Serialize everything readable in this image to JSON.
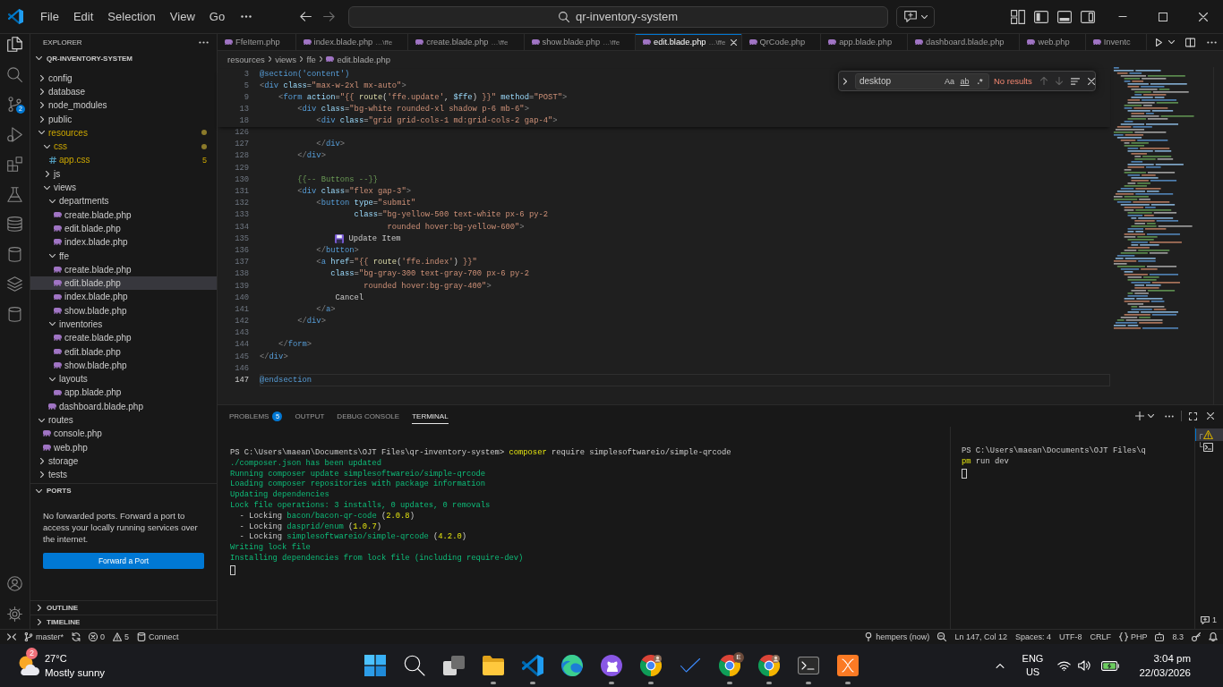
{
  "title_bar": {
    "menu": [
      "File",
      "Edit",
      "Selection",
      "View",
      "Go"
    ],
    "search": "qr-inventory-system",
    "layout_toggles": [
      {
        "kind": "primary-sidebar",
        "on": true
      },
      {
        "kind": "panel",
        "on": true
      },
      {
        "kind": "secondary-sidebar",
        "on": false
      }
    ]
  },
  "activity_bar": {
    "items": [
      {
        "kind": "explorer",
        "selected": true
      },
      {
        "kind": "search",
        "selected": false
      },
      {
        "kind": "source-control",
        "selected": false,
        "badge": "2"
      },
      {
        "kind": "run-debug",
        "selected": false
      },
      {
        "kind": "extensions",
        "selected": false
      },
      {
        "kind": "testing",
        "selected": false
      },
      {
        "kind": "database",
        "selected": false
      },
      {
        "kind": "cylinder",
        "selected": false
      },
      {
        "kind": "layers",
        "selected": false
      },
      {
        "kind": "cylinder",
        "selected": false
      }
    ],
    "bottom": [
      {
        "kind": "account"
      },
      {
        "kind": "settings"
      }
    ]
  },
  "sidebar": {
    "title": "EXPLORER",
    "root": {
      "label": "QR-INVENTORY-SYSTEM",
      "expanded": true
    },
    "tree": [
      {
        "kind": "folder",
        "label": "config",
        "expanded": false,
        "selected": false,
        "warning": false
      },
      {
        "kind": "folder",
        "label": "database",
        "expanded": false,
        "selected": false,
        "warning": false
      },
      {
        "kind": "folder",
        "label": "node_modules",
        "expanded": false,
        "selected": false,
        "warning": false
      },
      {
        "kind": "folder",
        "label": "public",
        "expanded": false,
        "selected": false,
        "warning": false
      },
      {
        "kind": "folder",
        "label": "resources",
        "expanded": true,
        "selected": false,
        "warning": true,
        "children": [
          {
            "kind": "folder",
            "label": "css",
            "expanded": true,
            "selected": false,
            "warning": true,
            "children": [
              {
                "kind": "css-file",
                "label": "app.css",
                "selected": false,
                "warning": true,
                "badge": "5"
              }
            ]
          },
          {
            "kind": "folder",
            "label": "js",
            "expanded": false,
            "selected": false,
            "warning": false
          },
          {
            "kind": "folder",
            "label": "views",
            "expanded": true,
            "selected": false,
            "warning": false,
            "children": [
              {
                "kind": "folder",
                "label": "departments",
                "expanded": true,
                "selected": false,
                "warning": false,
                "children": [
                  {
                    "kind": "php-file",
                    "label": "create.blade.php",
                    "selected": false,
                    "warning": false
                  },
                  {
                    "kind": "php-file",
                    "label": "edit.blade.php",
                    "selected": false,
                    "warning": false
                  },
                  {
                    "kind": "php-file",
                    "label": "index.blade.php",
                    "selected": false,
                    "warning": false
                  }
                ]
              },
              {
                "kind": "folder",
                "label": "ffe",
                "expanded": true,
                "selected": false,
                "warning": false,
                "children": [
                  {
                    "kind": "php-file",
                    "label": "create.blade.php",
                    "selected": false,
                    "warning": false
                  },
                  {
                    "kind": "php-file",
                    "label": "edit.blade.php",
                    "selected": true,
                    "warning": false
                  },
                  {
                    "kind": "php-file",
                    "label": "index.blade.php",
                    "selected": false,
                    "warning": false
                  },
                  {
                    "kind": "php-file",
                    "label": "show.blade.php",
                    "selected": false,
                    "warning": false
                  }
                ]
              },
              {
                "kind": "folder",
                "label": "inventories",
                "expanded": true,
                "selected": false,
                "warning": false,
                "children": [
                  {
                    "kind": "php-file",
                    "label": "create.blade.php",
                    "selected": false,
                    "warning": false
                  },
                  {
                    "kind": "php-file",
                    "label": "edit.blade.php",
                    "selected": false,
                    "warning": false
                  },
                  {
                    "kind": "php-file",
                    "label": "show.blade.php",
                    "selected": false,
                    "warning": false
                  }
                ]
              },
              {
                "kind": "folder",
                "label": "layouts",
                "expanded": true,
                "selected": false,
                "warning": false,
                "children": [
                  {
                    "kind": "php-file",
                    "label": "app.blade.php",
                    "selected": false,
                    "warning": false
                  }
                ]
              },
              {
                "kind": "php-file",
                "label": "dashboard.blade.php",
                "selected": false,
                "warning": false
              }
            ]
          }
        ]
      },
      {
        "kind": "folder",
        "label": "routes",
        "expanded": true,
        "selected": false,
        "warning": false,
        "children": [
          {
            "kind": "php-file",
            "label": "console.php",
            "selected": false,
            "warning": false
          },
          {
            "kind": "php-file",
            "label": "web.php",
            "selected": false,
            "warning": false
          }
        ]
      },
      {
        "kind": "folder",
        "label": "storage",
        "expanded": false,
        "selected": false,
        "warning": false
      },
      {
        "kind": "folder",
        "label": "tests",
        "expanded": false,
        "selected": false,
        "warning": false
      }
    ],
    "sections": [
      {
        "title": "PORTS",
        "expanded": true,
        "message": "No forwarded ports. Forward a port to access your locally running services over the internet.",
        "button": "Forward a Port"
      },
      {
        "title": "OUTLINE",
        "expanded": false
      },
      {
        "title": "TIMELINE",
        "expanded": false
      }
    ]
  },
  "editor": {
    "tabs": [
      {
        "label": "FfeItem.php",
        "selected": false
      },
      {
        "label": "index.blade.php",
        "description": "…\\ffe",
        "selected": false
      },
      {
        "label": "create.blade.php",
        "description": "…\\ffe",
        "selected": false
      },
      {
        "label": "show.blade.php",
        "description": "…\\ffe",
        "selected": false
      },
      {
        "label": "edit.blade.php",
        "description": "…\\ffe",
        "selected": true
      },
      {
        "label": "QrCode.php",
        "selected": false
      },
      {
        "label": "app.blade.php",
        "selected": false
      },
      {
        "label": "dashboard.blade.php",
        "selected": false
      },
      {
        "label": "web.php",
        "selected": false
      },
      {
        "label": "Inventc",
        "selected": false
      }
    ],
    "breadcrumbs": [
      "resources",
      "views",
      "ffe",
      "edit.blade.php"
    ],
    "find": {
      "replace_expanded": false,
      "value": "desktop",
      "options": [
        {
          "label": "Aa",
          "on": false
        },
        {
          "label": "ab",
          "on": false
        },
        {
          "label": ".*",
          "on": false
        }
      ],
      "result": "No results",
      "navigation_disabled": true
    },
    "sticky_lines": [
      {
        "number": "3",
        "tokens": [
          {
            "kind": "directive",
            "text": "@section('content')"
          }
        ]
      },
      {
        "number": "5",
        "tokens": [
          {
            "kind": "bracket",
            "text": "<"
          },
          {
            "kind": "tag",
            "text": "div"
          },
          {
            "kind": "attribute",
            "text": " class"
          },
          {
            "kind": "plain",
            "text": "="
          },
          {
            "kind": "string",
            "text": "\"max-w-2xl mx-auto\""
          },
          {
            "kind": "bracket",
            "text": ">"
          }
        ]
      },
      {
        "number": "9",
        "tokens": [
          {
            "kind": "bracket",
            "text": "    <"
          },
          {
            "kind": "tag",
            "text": "form"
          },
          {
            "kind": "attribute",
            "text": " action"
          },
          {
            "kind": "plain",
            "text": "="
          },
          {
            "kind": "string",
            "text": "\"{{ "
          },
          {
            "kind": "function",
            "text": "route"
          },
          {
            "kind": "plain",
            "text": "("
          },
          {
            "kind": "string",
            "text": "'ffe.update'"
          },
          {
            "kind": "plain",
            "text": ", "
          },
          {
            "kind": "variable",
            "text": "$ffe"
          },
          {
            "kind": "plain",
            "text": ") "
          },
          {
            "kind": "string",
            "text": "}}\""
          },
          {
            "kind": "attribute",
            "text": " method"
          },
          {
            "kind": "plain",
            "text": "="
          },
          {
            "kind": "string",
            "text": "\"POST\""
          },
          {
            "kind": "bracket",
            "text": ">"
          }
        ]
      },
      {
        "number": "13",
        "tokens": [
          {
            "kind": "bracket",
            "text": "        <"
          },
          {
            "kind": "tag",
            "text": "div"
          },
          {
            "kind": "attribute",
            "text": " class"
          },
          {
            "kind": "plain",
            "text": "="
          },
          {
            "kind": "string",
            "text": "\"bg-white rounded-xl shadow p-6 mb-6\""
          },
          {
            "kind": "bracket",
            "text": ">"
          }
        ]
      },
      {
        "number": "18",
        "tokens": [
          {
            "kind": "bracket",
            "text": "            <"
          },
          {
            "kind": "tag",
            "text": "div"
          },
          {
            "kind": "attribute",
            "text": " class"
          },
          {
            "kind": "plain",
            "text": "="
          },
          {
            "kind": "string",
            "text": "\"grid grid-cols-1 md:grid-cols-2 gap-4\""
          },
          {
            "kind": "bracket",
            "text": ">"
          }
        ]
      }
    ],
    "lines": [
      {
        "number": "126",
        "current": false
      },
      {
        "number": "127",
        "current": false,
        "tokens": [
          {
            "kind": "bracket",
            "text": "            </"
          },
          {
            "kind": "tag",
            "text": "div"
          },
          {
            "kind": "bracket",
            "text": ">"
          }
        ]
      },
      {
        "number": "128",
        "current": false,
        "tokens": [
          {
            "kind": "bracket",
            "text": "        </"
          },
          {
            "kind": "tag",
            "text": "div"
          },
          {
            "kind": "bracket",
            "text": ">"
          }
        ]
      },
      {
        "number": "129",
        "current": false
      },
      {
        "number": "130",
        "current": false,
        "tokens": [
          {
            "kind": "comment",
            "text": "        {{-- Buttons --}}"
          }
        ]
      },
      {
        "number": "131",
        "current": false,
        "tokens": [
          {
            "kind": "bracket",
            "text": "        <"
          },
          {
            "kind": "tag",
            "text": "div"
          },
          {
            "kind": "attribute",
            "text": " class"
          },
          {
            "kind": "plain",
            "text": "="
          },
          {
            "kind": "string",
            "text": "\"flex gap-3\""
          },
          {
            "kind": "bracket",
            "text": ">"
          }
        ]
      },
      {
        "number": "132",
        "current": false,
        "tokens": [
          {
            "kind": "bracket",
            "text": "            <"
          },
          {
            "kind": "tag",
            "text": "button"
          },
          {
            "kind": "attribute",
            "text": " type"
          },
          {
            "kind": "plain",
            "text": "="
          },
          {
            "kind": "string",
            "text": "\"submit\""
          }
        ]
      },
      {
        "number": "133",
        "current": false,
        "tokens": [
          {
            "kind": "attribute",
            "text": "                    class"
          },
          {
            "kind": "plain",
            "text": "="
          },
          {
            "kind": "string",
            "text": "\"bg-yellow-500 text-white px-6 py-2"
          }
        ]
      },
      {
        "number": "134",
        "current": false,
        "tokens": [
          {
            "kind": "string",
            "text": "                           rounded hover:bg-yellow-600\""
          },
          {
            "kind": "bracket",
            "text": ">"
          }
        ]
      },
      {
        "number": "135",
        "current": false,
        "tokens": [
          {
            "kind": "emoji",
            "text": "                Update Item"
          }
        ]
      },
      {
        "number": "136",
        "current": false,
        "tokens": [
          {
            "kind": "bracket",
            "text": "            </"
          },
          {
            "kind": "tag",
            "text": "button"
          },
          {
            "kind": "bracket",
            "text": ">"
          }
        ]
      },
      {
        "number": "137",
        "current": false,
        "tokens": [
          {
            "kind": "bracket",
            "text": "            <"
          },
          {
            "kind": "tag",
            "text": "a"
          },
          {
            "kind": "attribute",
            "text": " href"
          },
          {
            "kind": "plain",
            "text": "="
          },
          {
            "kind": "string",
            "text": "\"{{ "
          },
          {
            "kind": "function",
            "text": "route"
          },
          {
            "kind": "plain",
            "text": "("
          },
          {
            "kind": "string",
            "text": "'ffe.index'"
          },
          {
            "kind": "plain",
            "text": ") "
          },
          {
            "kind": "string",
            "text": "}}\""
          }
        ]
      },
      {
        "number": "138",
        "current": false,
        "tokens": [
          {
            "kind": "attribute",
            "text": "               class"
          },
          {
            "kind": "plain",
            "text": "="
          },
          {
            "kind": "string",
            "text": "\"bg-gray-300 text-gray-700 px-6 py-2"
          }
        ]
      },
      {
        "number": "139",
        "current": false,
        "tokens": [
          {
            "kind": "string",
            "text": "                      rounded hover:bg-gray-400\""
          },
          {
            "kind": "bracket",
            "text": ">"
          }
        ]
      },
      {
        "number": "140",
        "current": false,
        "tokens": [
          {
            "kind": "plain",
            "text": "                Cancel"
          }
        ]
      },
      {
        "number": "141",
        "current": false,
        "tokens": [
          {
            "kind": "bracket",
            "text": "            </"
          },
          {
            "kind": "tag",
            "text": "a"
          },
          {
            "kind": "bracket",
            "text": ">"
          }
        ]
      },
      {
        "number": "142",
        "current": false,
        "tokens": [
          {
            "kind": "bracket",
            "text": "        </"
          },
          {
            "kind": "tag",
            "text": "div"
          },
          {
            "kind": "bracket",
            "text": ">"
          }
        ]
      },
      {
        "number": "143",
        "current": false
      },
      {
        "number": "144",
        "current": false,
        "tokens": [
          {
            "kind": "bracket",
            "text": "    </"
          },
          {
            "kind": "tag",
            "text": "form"
          },
          {
            "kind": "bracket",
            "text": ">"
          }
        ]
      },
      {
        "number": "145",
        "current": false,
        "tokens": [
          {
            "kind": "bracket",
            "text": "</"
          },
          {
            "kind": "tag",
            "text": "div"
          },
          {
            "kind": "bracket",
            "text": ">"
          }
        ]
      },
      {
        "number": "146",
        "current": false
      },
      {
        "number": "147",
        "current": true,
        "tokens": [
          {
            "kind": "directive",
            "text": "@endsection"
          }
        ]
      }
    ]
  },
  "panel": {
    "tabs": [
      {
        "label": "PROBLEMS",
        "badge": "5",
        "selected": false
      },
      {
        "label": "OUTPUT",
        "selected": false
      },
      {
        "label": "DEBUG CONSOLE",
        "selected": false
      },
      {
        "label": "TERMINAL",
        "selected": true
      }
    ],
    "terminals": [
      {
        "lines": [
          [
            {
              "kind": "plain",
              "text": "PS C:\\Users\\maean\\Documents\\OJT Files\\qr-inventory-system> "
            },
            {
              "kind": "command",
              "text": "composer"
            },
            {
              "kind": "plain",
              "text": " require simplesoftwareio/simple-qrcode"
            }
          ],
          [
            {
              "kind": "success",
              "text": "./composer.json has been updated"
            }
          ],
          [
            {
              "kind": "success",
              "text": "Running composer update simplesoftwareio/simple-qrcode"
            }
          ],
          [
            {
              "kind": "success",
              "text": "Loading composer repositories with package information"
            }
          ],
          [
            {
              "kind": "success",
              "text": "Updating dependencies"
            }
          ],
          [
            {
              "kind": "success",
              "text": "Lock file operations: 3 installs, 0 updates, 0 removals"
            }
          ],
          [
            {
              "kind": "plain",
              "text": "  - Locking "
            },
            {
              "kind": "success",
              "text": "bacon/bacon-qr-code"
            },
            {
              "kind": "plain",
              "text": " ("
            },
            {
              "kind": "version",
              "text": "2.0.8"
            },
            {
              "kind": "plain",
              "text": ")"
            }
          ],
          [
            {
              "kind": "plain",
              "text": "  - Locking "
            },
            {
              "kind": "success",
              "text": "dasprid/enum"
            },
            {
              "kind": "plain",
              "text": " ("
            },
            {
              "kind": "version",
              "text": "1.0.7"
            },
            {
              "kind": "plain",
              "text": ")"
            }
          ],
          [
            {
              "kind": "plain",
              "text": "  - Locking "
            },
            {
              "kind": "success",
              "text": "simplesoftwareio/simple-qrcode"
            },
            {
              "kind": "plain",
              "text": " ("
            },
            {
              "kind": "version",
              "text": "4.2.0"
            },
            {
              "kind": "plain",
              "text": ")"
            }
          ],
          [
            {
              "kind": "success",
              "text": "Writing lock file"
            }
          ],
          [
            {
              "kind": "success",
              "text": "Installing dependencies from lock file (including require-dev)"
            }
          ]
        ]
      },
      {
        "lines": [
          [
            {
              "kind": "plain",
              "text": "PS C:\\Users\\maean\\Documents\\OJT Files\\q"
            }
          ],
          [
            {
              "kind": "command",
              "text": "pm"
            },
            {
              "kind": "plain",
              "text": " run dev"
            }
          ]
        ]
      }
    ],
    "terminal_list": [
      {
        "connector": "┌",
        "kind": "warning",
        "selected": true
      },
      {
        "connector": "└",
        "kind": "shell",
        "selected": false
      }
    ],
    "terminal_count": "1"
  },
  "status_bar": {
    "left": [
      {
        "kind": "remote"
      },
      {
        "kind": "branch",
        "text": "master*"
      },
      {
        "kind": "sync"
      },
      {
        "kind": "error",
        "text": "0"
      },
      {
        "kind": "warning",
        "text": "5"
      },
      {
        "kind": "database",
        "text": "Connect"
      }
    ],
    "right": [
      {
        "kind": "pin",
        "text": "hempers (now)"
      },
      {
        "kind": "zoom"
      },
      {
        "kind": "text",
        "text": "Ln 147, Col 12"
      },
      {
        "kind": "text",
        "text": "Spaces: 4"
      },
      {
        "kind": "text",
        "text": "UTF-8"
      },
      {
        "kind": "text",
        "text": "CRLF"
      },
      {
        "kind": "braces",
        "text": "PHP"
      },
      {
        "kind": "robot"
      },
      {
        "kind": "text",
        "text": "8.3"
      },
      {
        "kind": "key"
      },
      {
        "kind": "bell"
      }
    ]
  },
  "taskbar": {
    "weather": {
      "badge": "2",
      "temperature": "27°C",
      "condition": "Mostly sunny"
    },
    "apps": [
      {
        "kind": "start",
        "running": false
      },
      {
        "kind": "search",
        "running": false
      },
      {
        "kind": "task-view",
        "running": false
      },
      {
        "kind": "folder",
        "running": true
      },
      {
        "kind": "code-editor",
        "running": true
      },
      {
        "kind": "edge",
        "running": false
      },
      {
        "kind": "github",
        "running": true
      },
      {
        "kind": "chrome",
        "running": true,
        "avatar": true
      },
      {
        "kind": "todo",
        "running": false
      },
      {
        "kind": "chrome",
        "running": true,
        "avatar": false,
        "badge": "E"
      },
      {
        "kind": "chrome",
        "running": true,
        "avatar": true
      },
      {
        "kind": "terminal",
        "running": true
      },
      {
        "kind": "xampp",
        "running": true
      }
    ],
    "tray": {
      "language": "ENG",
      "region": "US",
      "time": "3:04 pm",
      "date": "22/03/2026"
    }
  }
}
